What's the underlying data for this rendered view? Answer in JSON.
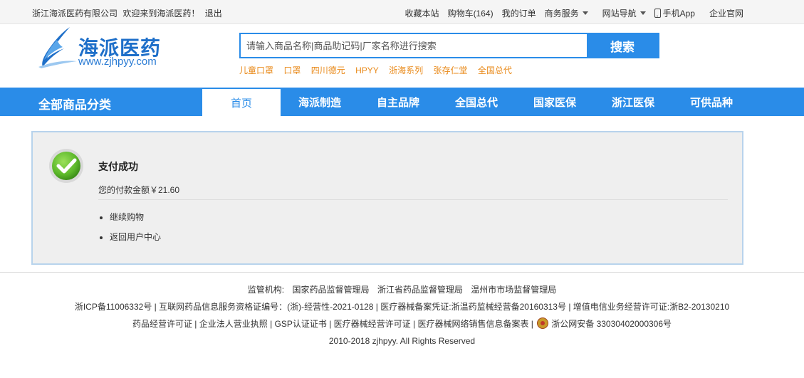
{
  "topbar": {
    "company": "浙江海派医药有限公司",
    "welcome": "欢迎来到海派医药！",
    "logout": "退出",
    "bookmark": "收藏本站",
    "cart": "购物车(164)",
    "orders": "我的订单",
    "business": "商务服务",
    "site_nav": "网站导航",
    "mobile_app": "手机App",
    "official_site": "企业官网"
  },
  "header": {
    "logo_cn": "海派医药",
    "logo_en": "www.zjhpyy.com",
    "search_placeholder": "请输入商品名称|商品助记码|厂家名称进行搜索",
    "search_button": "搜索",
    "hotwords": [
      "儿童口罩",
      "口罩",
      "四川德元",
      "HPYY",
      "浙海系列",
      "张存仁堂",
      "全国总代"
    ]
  },
  "nav": {
    "all_categories": "全部商品分类",
    "tabs": [
      "首页",
      "海派制造",
      "自主品牌",
      "全国总代",
      "国家医保",
      "浙江医保",
      "可供品种"
    ]
  },
  "result": {
    "title": "支付成功",
    "amount": "您的付款金额￥21.60",
    "links": [
      "继续购物",
      "返回用户中心"
    ]
  },
  "footer": {
    "supervision_label": "监管机构:",
    "agencies": [
      "国家药品监督管理局",
      "浙江省药品监督管理局",
      "温州市市场监督管理局"
    ],
    "licenses_line": "浙ICP备11006332号 | 互联网药品信息服务资格证编号：(浙)-经营性-2021-0128 | 医疗器械备案凭证:浙温药监械经营备20160313号 | 增值电信业务经营许可证:浙B2-20130210",
    "certs_line": "药品经营许可证 | 企业法人营业执照 | GSP认证证书 | 医疗器械经营许可证 | 医疗器械网络销售信息备案表 |",
    "police_record": "浙公网安备 33030402000306号",
    "copyright": "2010-2018 zjhpyy. All Rights Reserved"
  },
  "colors": {
    "primary_blue": "#2a8ce8",
    "hotword_orange": "#e98a1a",
    "success_green": "#5cb82a"
  }
}
